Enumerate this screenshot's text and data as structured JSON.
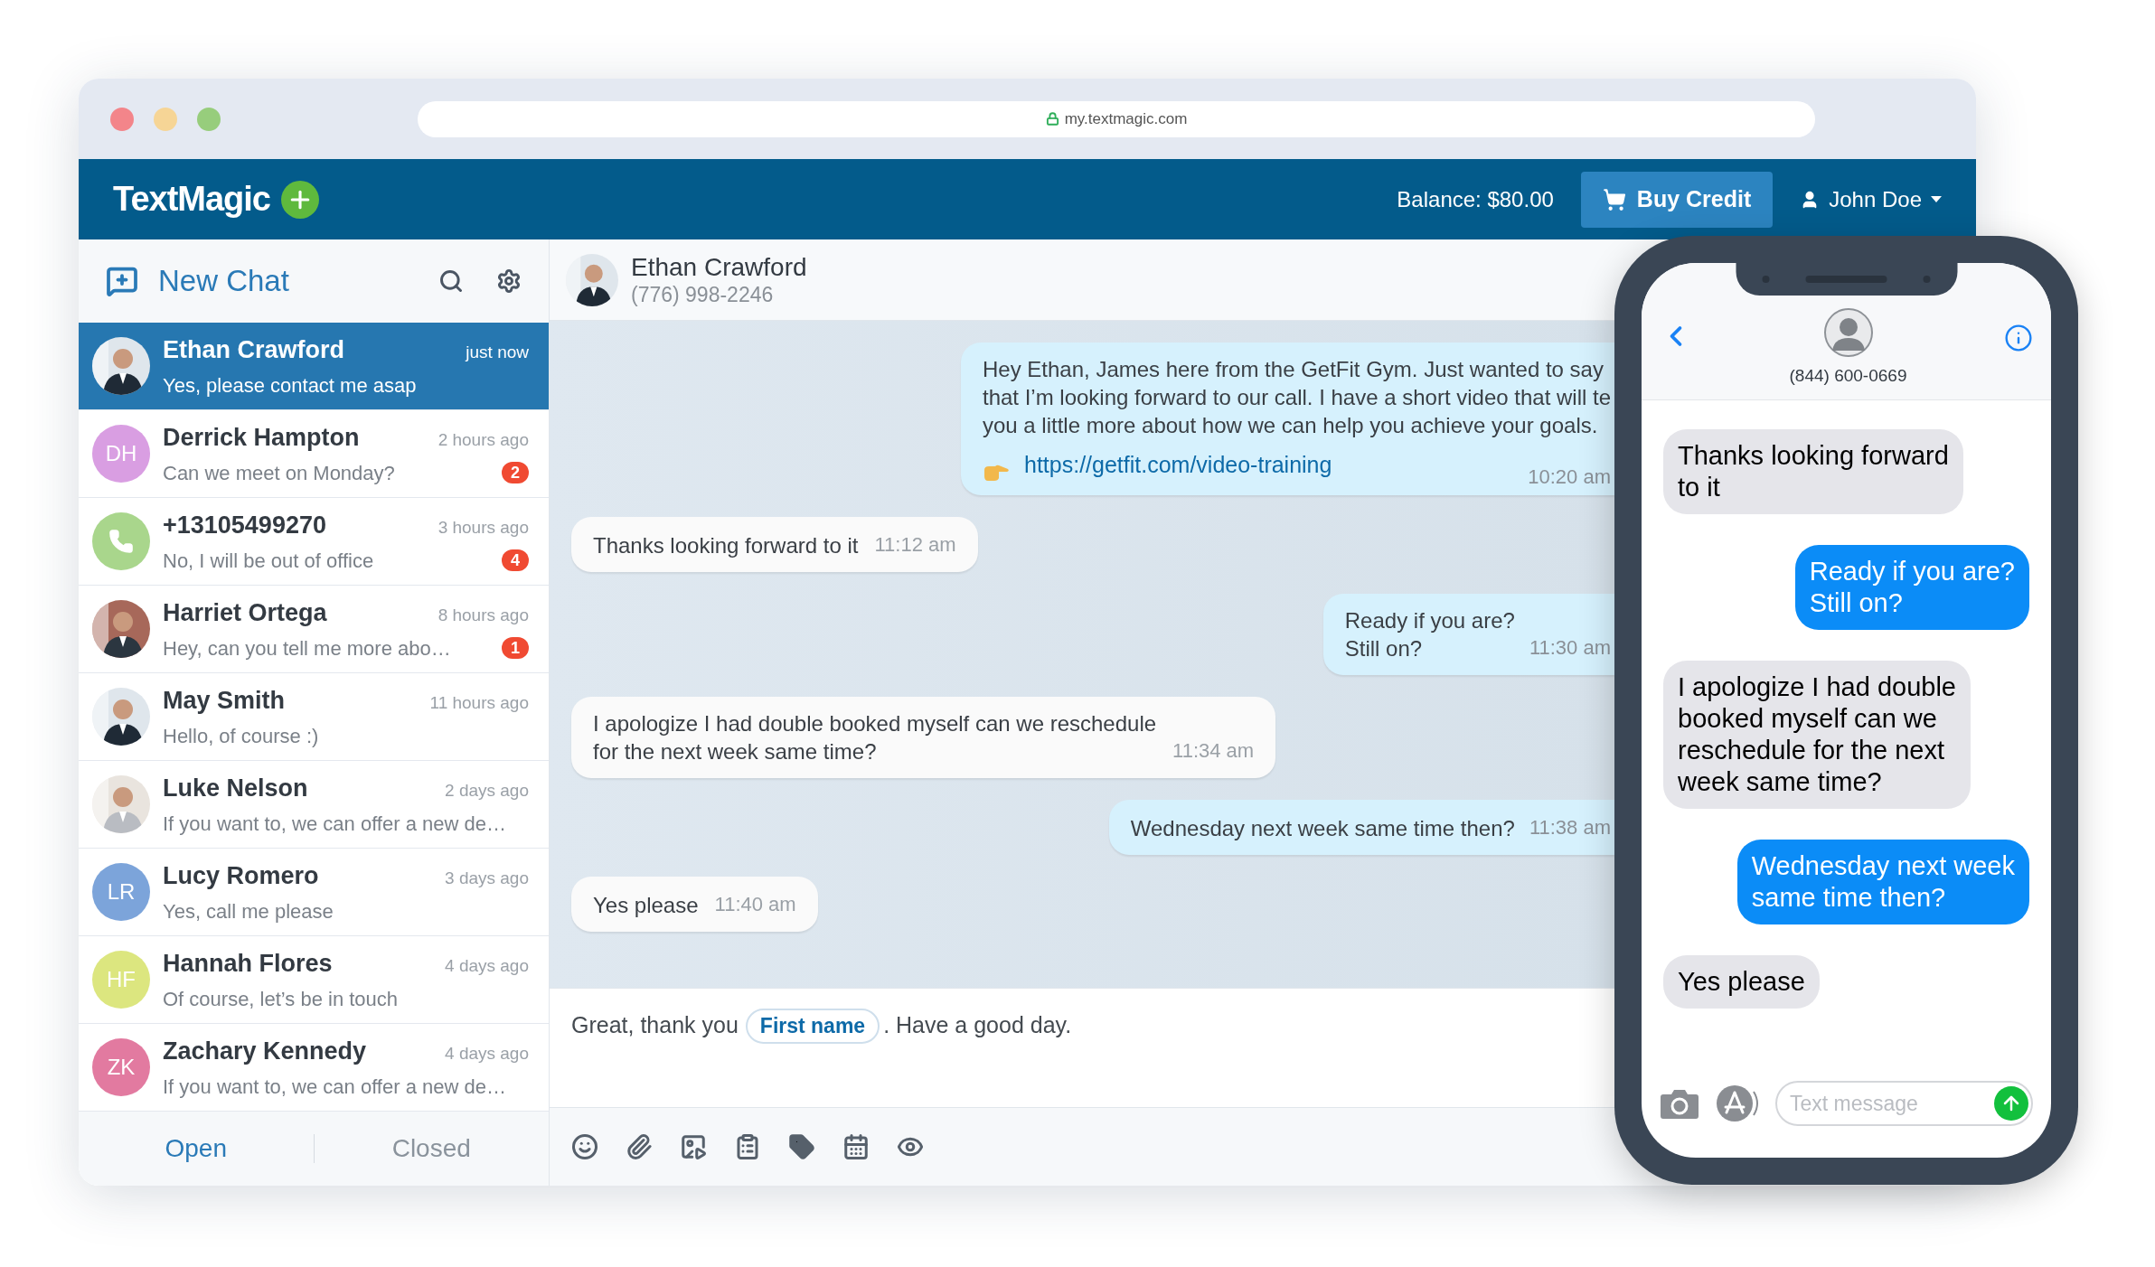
{
  "browser": {
    "url": "my.textmagic.com"
  },
  "header": {
    "logo": "TextMagic",
    "balance": "Balance: $80.00",
    "buy_button": "Buy Credit",
    "user": "John Doe"
  },
  "sidebar": {
    "title": "New Chat",
    "conversations": [
      {
        "name": "Ethan Crawford",
        "preview": "Yes, please contact me asap",
        "time": "just now",
        "selected": true
      },
      {
        "name": "Derrick Hampton",
        "preview": "Can we meet on Monday?",
        "time": "2 hours ago",
        "avatar": {
          "kind": "initials",
          "initials": "DH",
          "color": "#d99ee2"
        },
        "badge": "2",
        "selected": false
      },
      {
        "name": "+13105499270",
        "preview": "No, I will be out of office",
        "time": "3 hours ago",
        "avatar": {
          "kind": "phone",
          "color": "#a9d68c"
        },
        "badge": "4",
        "selected": false
      },
      {
        "name": "Harriet Ortega",
        "preview": "Hey, can you tell me more abo…",
        "time": "8 hours ago",
        "badge": "1",
        "selected": false
      },
      {
        "name": "May Smith",
        "preview": "Hello, of course :)",
        "time": "11 hours ago",
        "selected": false
      },
      {
        "name": "Luke Nelson",
        "preview": "If you want to, we can offer a new de…",
        "time": "2 days ago",
        "selected": false
      },
      {
        "name": "Lucy Romero",
        "preview": "Yes, call me please",
        "time": "3 days ago",
        "avatar": {
          "kind": "initials",
          "initials": "LR",
          "color": "#7ca4da"
        },
        "selected": false
      },
      {
        "name": "Hannah Flores",
        "preview": "Of course, let’s be in touch",
        "time": "4 days ago",
        "avatar": {
          "kind": "initials",
          "initials": "HF",
          "color": "#dce67f"
        },
        "selected": false
      },
      {
        "name": "Zachary Kennedy",
        "preview": "If you want to, we can offer a new de…",
        "time": "4 days ago",
        "avatar": {
          "kind": "initials",
          "initials": "ZK",
          "color": "#e27aa0"
        },
        "selected": false
      }
    ],
    "tabs": [
      {
        "label": "Open",
        "selected": true
      },
      {
        "label": "Closed",
        "selected": false
      }
    ]
  },
  "chat": {
    "contact": {
      "name": "Ethan Crawford",
      "phone": "(776) 998-2246"
    },
    "messages": [
      {
        "kind": "out",
        "lines": [
          "Hey Ethan, James here from the GetFit Gym. Just wanted to say",
          "that I’m looking forward to our call. I have a short video that will te",
          "you a little more about how we can help you achieve your goals."
        ],
        "link": "https://getfit.com/video-training",
        "time": "10:20 am"
      },
      {
        "kind": "in",
        "lines": [
          "Thanks looking forward to it"
        ],
        "time": "11:12 am"
      },
      {
        "kind": "out",
        "lines": [
          "Ready if you are?",
          "Still on?"
        ],
        "time": "11:30 am"
      },
      {
        "kind": "in",
        "lines": [
          "I apologize I had double booked myself can we reschedule",
          "for the next week same time?"
        ],
        "time": "11:34 am"
      },
      {
        "kind": "out",
        "lines": [
          "Wednesday next week same time then?"
        ],
        "time": "11:38 am"
      },
      {
        "kind": "in",
        "lines": [
          "Yes please"
        ],
        "time": "11:40 am"
      }
    ],
    "composer": {
      "before": "Great, thank you",
      "tag": "First name",
      "after": ". Have a good day."
    }
  },
  "phone": {
    "contact": "(844) 600-0669",
    "messages": [
      {
        "kind": "in",
        "lines": [
          "Thanks looking forward",
          "to it"
        ]
      },
      {
        "kind": "out",
        "lines": [
          "Ready if you are?",
          "Still on?"
        ]
      },
      {
        "kind": "in",
        "lines": [
          "I apologize I had double",
          "booked myself can we",
          "reschedule for the next",
          "week same time?"
        ]
      },
      {
        "kind": "out",
        "lines": [
          "Wednesday next week",
          "same time then?"
        ]
      },
      {
        "kind": "in",
        "lines": [
          "Yes please"
        ]
      }
    ],
    "input": {
      "placeholder": "Text message"
    }
  }
}
